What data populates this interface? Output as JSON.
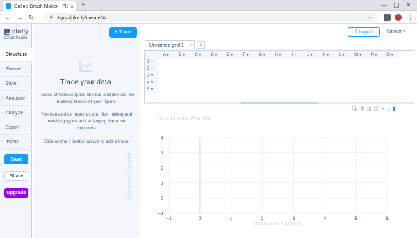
{
  "browser": {
    "tab_title": "Online Graph Maker · Plo",
    "tab_close": "×",
    "new_tab": "+",
    "url": "https://plot.ly/create/#/",
    "controls": {
      "minimize": "—",
      "maximize": "▢",
      "close": "✕"
    }
  },
  "sidebar": {
    "brand": "plotly",
    "subtitle": "Chart Studio",
    "items": [
      {
        "label": "Structure",
        "active": true
      },
      {
        "label": "Theme"
      },
      {
        "label": "Style"
      },
      {
        "label": "Annotate"
      },
      {
        "label": "Analyze"
      },
      {
        "label": "Export"
      },
      {
        "label": "JSON"
      }
    ],
    "save_label": "Save",
    "share_label": "Share",
    "upgrade_label": "Upgrade"
  },
  "panel": {
    "add_trace_label": "+ Trace",
    "title": "Trace your data.",
    "text1": "Traces of various types like bar and line are the building blocks of your figure.",
    "text2": "You can add as many as you like, mixing and matching types and arranging them into subplots.",
    "text3": "Click on the + button above to add a trace."
  },
  "header": {
    "import_label": "Import",
    "user": "lathkar ▾"
  },
  "grid": {
    "tab_label": "Unnamed grid 1",
    "tab_close": "×",
    "add_tab": "+",
    "columns": [
      "A",
      "B",
      "C",
      "D",
      "E",
      "F",
      "G",
      "H",
      "I",
      "J",
      "K",
      "L",
      "M",
      "N",
      "O"
    ],
    "rows": [
      "1",
      "2",
      "3",
      "4",
      "5"
    ]
  },
  "plot": {
    "title_placeholder": "Click to enter Plot title",
    "x_title_placeholder": "Click to enter X axis title",
    "y_title_placeholder": "Click to enter Y axis title",
    "x_ticks": [
      "−1",
      "0",
      "1",
      "2",
      "3",
      "4",
      "5",
      "6"
    ],
    "y_ticks": [
      "−1",
      "0",
      "1",
      "2",
      "3",
      "4"
    ],
    "modebar": [
      "zoom-icon",
      "pan-icon",
      "zoom-in-icon",
      "zoom-out-icon",
      "autoscale-icon",
      "reset-icon",
      "plotly-logo-icon"
    ]
  },
  "colors": {
    "accent": "#119dff",
    "upgrade": "#9b00e8",
    "panel_bg": "#f3f6fa",
    "grid_line": "#ebf0f8"
  }
}
